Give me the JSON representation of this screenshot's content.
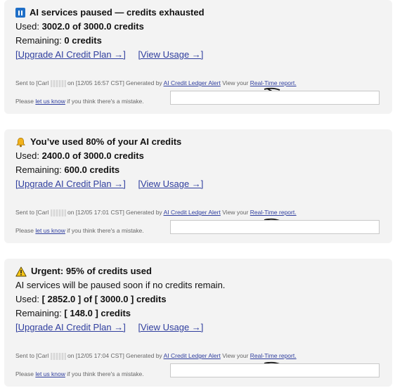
{
  "alerts": [
    {
      "icon": "pause-icon",
      "title": "AI services paused — credits exhausted",
      "note": "",
      "used_label": "Used: ",
      "used_value": "3002.0 of 3000.0 credits",
      "remaining_label": "Remaining: ",
      "remaining_value": "0 credits",
      "upgrade_link": "[Upgrade AI Credit Plan →]",
      "usage_link": "[View Usage →]",
      "footer": {
        "sent_to": "Sent to [Carl",
        "sent_on": "on [12/05 16:57 CST] Generated by",
        "generator": "AI Credit Ledger Alert",
        "view_prefix": "View your",
        "report_link": "Real-Time report.",
        "please": "Please",
        "let_us_know": "let us know",
        "mistake": "if you think there's a mistake."
      }
    },
    {
      "icon": "bell-icon",
      "title": "You’ve used 80% of your AI credits",
      "note": "",
      "used_label": "Used: ",
      "used_value": "2400.0 of 3000.0 credits",
      "remaining_label": "Remaining: ",
      "remaining_value": "600.0 credits",
      "upgrade_link": "[Upgrade AI Credit Plan →]",
      "usage_link": "[View Usage →]",
      "footer": {
        "sent_to": "Sent to [Carl",
        "sent_on": "on [12/05 17:01 CST] Generated by",
        "generator": "AI Credit Ledger Alert",
        "view_prefix": "View your",
        "report_link": "Real-Time report.",
        "please": "Please",
        "let_us_know": "let us know",
        "mistake": "if you think there's a mistake."
      }
    },
    {
      "icon": "warning-icon",
      "title": "Urgent: 95% of credits used",
      "note": "AI services will be paused soon if no credits remain.",
      "used_label": "Used: ",
      "used_value": "[ 2852.0 ] of [ 3000.0 ] credits",
      "remaining_label": "Remaining: ",
      "remaining_value": "[ 148.0 ] credits",
      "upgrade_link": "[Upgrade AI Credit Plan →]",
      "usage_link": "[View Usage →]",
      "footer": {
        "sent_to": "Sent to [Carl",
        "sent_on": "on [12/05 17:04 CST] Generated by",
        "generator": "AI Credit Ledger Alert",
        "view_prefix": "View your",
        "report_link": "Real-Time report.",
        "please": "Please",
        "let_us_know": "let us know",
        "mistake": "if you think there's a mistake."
      }
    }
  ]
}
